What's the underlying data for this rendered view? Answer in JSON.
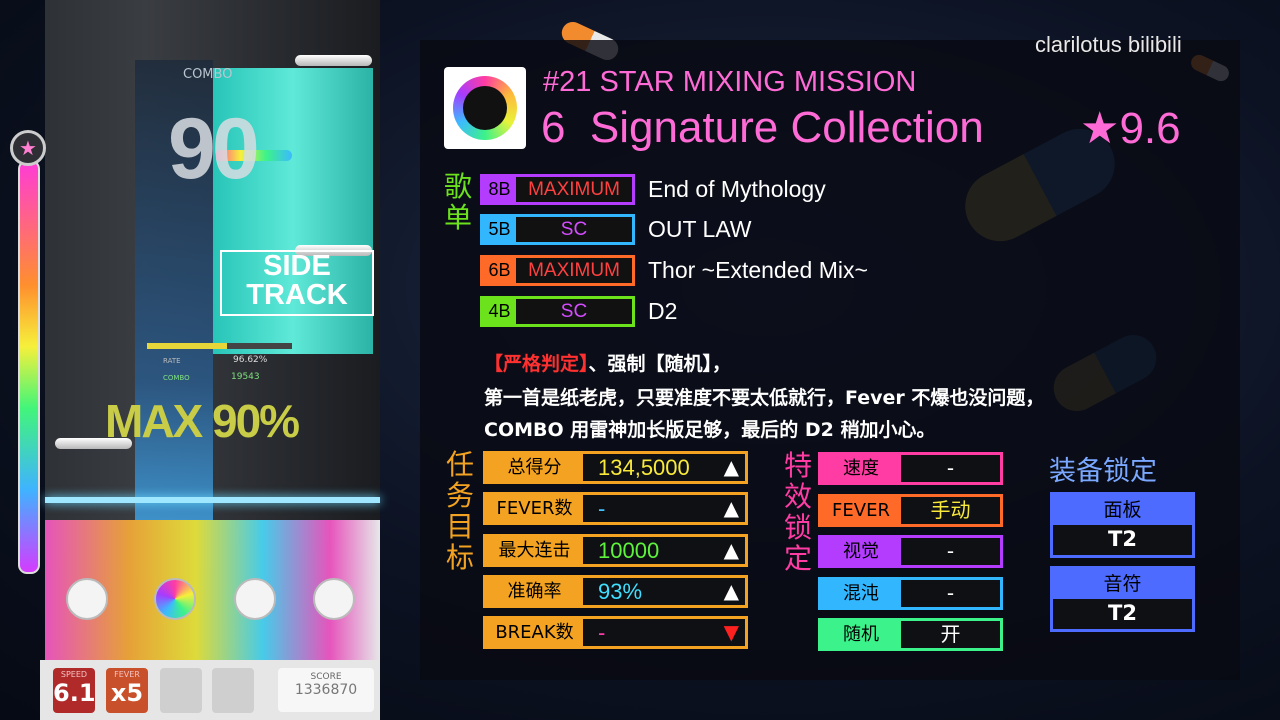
{
  "game": {
    "combo_label": "COMBO",
    "combo_number": "90",
    "side_track": [
      "SIDE",
      "TRACK"
    ],
    "rate_label": "RATE",
    "rate_value": "96.62%",
    "combo_small_label": "COMBO",
    "combo_small_value": "19543",
    "max_text": "MAX 90%",
    "speed_label": "SPEED",
    "speed_value": "6.1",
    "fever_label": "FEVER",
    "fever_value": "x5",
    "score_label": "SCORE",
    "score_value": "1336870",
    "gauge_star_icon": "star-icon"
  },
  "watermark": "clarilotus bilibili",
  "mission": {
    "title": "#21 STAR MIXING MISSION",
    "collection": "6  Signature Collection",
    "stars": "★9.6"
  },
  "song_list": {
    "label": "歌单",
    "songs": [
      {
        "level": "8B",
        "difficulty": "MAXIMUM",
        "name": "End of Mythology",
        "color": "#b33cff",
        "diff_color": "#ff4040"
      },
      {
        "level": "5B",
        "difficulty": "SC",
        "name": "OUT LAW",
        "color": "#32b7ff",
        "diff_color": "#d44cff"
      },
      {
        "level": "6B",
        "difficulty": "MAXIMUM",
        "name": "Thor ~Extended Mix~",
        "color": "#ff6a28",
        "diff_color": "#ff4040"
      },
      {
        "level": "4B",
        "difficulty": "SC",
        "name": "D2",
        "color": "#6be21b",
        "diff_color": "#d44cff"
      }
    ]
  },
  "description": {
    "line1_a": "【严格判定】",
    "line1_b": "、强制【随机】，",
    "line2": "第一首是纸老虎，只要准度不要太低就行，Fever 不爆也没问题，",
    "line3": "COMBO 用雷神加长版足够，最后的 D2 稍加小心。"
  },
  "goals": {
    "label": "任务目标",
    "rows": [
      {
        "label": "总得分",
        "value": "134,5000",
        "value_color": "#f8e93a",
        "arrow": "▲",
        "arrow_color": "#ffffff"
      },
      {
        "label": "FEVER数",
        "value": "-",
        "value_color": "#3fc3ff",
        "arrow": "▲",
        "arrow_color": "#ffffff"
      },
      {
        "label": "最大连击",
        "value": "10000",
        "value_color": "#5df23b",
        "arrow": "▲",
        "arrow_color": "#ffffff"
      },
      {
        "label": "准确率",
        "value": "93%",
        "value_color": "#3fe0ff",
        "arrow": "▲",
        "arrow_color": "#ffffff"
      },
      {
        "label": "BREAK数",
        "value": "-",
        "value_color": "#ff3ca8",
        "arrow": "▼",
        "arrow_color": "#ff2020"
      }
    ]
  },
  "effects": {
    "label": "特效锁定",
    "rows": [
      {
        "label": "速度",
        "value": "-",
        "color": "#ff3ca3"
      },
      {
        "label": "FEVER",
        "value": "手动",
        "color": "#ff6a28",
        "value_color": "#f8e93a"
      },
      {
        "label": "视觉",
        "value": "-",
        "color": "#b33cff"
      },
      {
        "label": "混沌",
        "value": "-",
        "color": "#32b7ff"
      },
      {
        "label": "随机",
        "value": "开",
        "color": "#3cf28a"
      }
    ]
  },
  "equipment": {
    "title": "装备锁定",
    "items": [
      {
        "label": "面板",
        "value": "T2"
      },
      {
        "label": "音符",
        "value": "T2"
      }
    ]
  }
}
